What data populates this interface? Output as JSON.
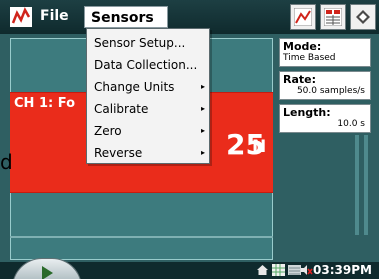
{
  "menubar": {
    "file_label": "File",
    "sensors_label": "Sensors"
  },
  "toolbar": {
    "buttons": [
      "graph-view-icon",
      "table-view-icon",
      "meter-view-icon"
    ]
  },
  "sensors_menu": {
    "items": [
      {
        "label": "Sensor Setup...",
        "has_submenu": false
      },
      {
        "label": "Data Collection...",
        "has_submenu": false
      },
      {
        "label": "Change Units",
        "has_submenu": true
      },
      {
        "label": "Calibrate",
        "has_submenu": true
      },
      {
        "label": "Zero",
        "has_submenu": true
      },
      {
        "label": "Reverse",
        "has_submenu": true
      }
    ],
    "submenu_arrow": "▸"
  },
  "meter": {
    "channel_label": "CH 1: Fo",
    "reading": "25",
    "unit": "N"
  },
  "edge_text": "d",
  "info_panel": {
    "mode_title": "Mode:",
    "mode_value": "Time Based",
    "rate_title": "Rate:",
    "rate_value": "50.0 samples/s",
    "length_title": "Length:",
    "length_value": "10.0 s"
  },
  "status_bar": {
    "time": "03:39PM",
    "icons": [
      "home-icon",
      "grid-icon",
      "keyboard-icon",
      "volume-muted-icon"
    ]
  },
  "colors": {
    "background": "#2f5f62",
    "meter_red": "#ea2c1b",
    "menubar": "#0f2a2d"
  }
}
